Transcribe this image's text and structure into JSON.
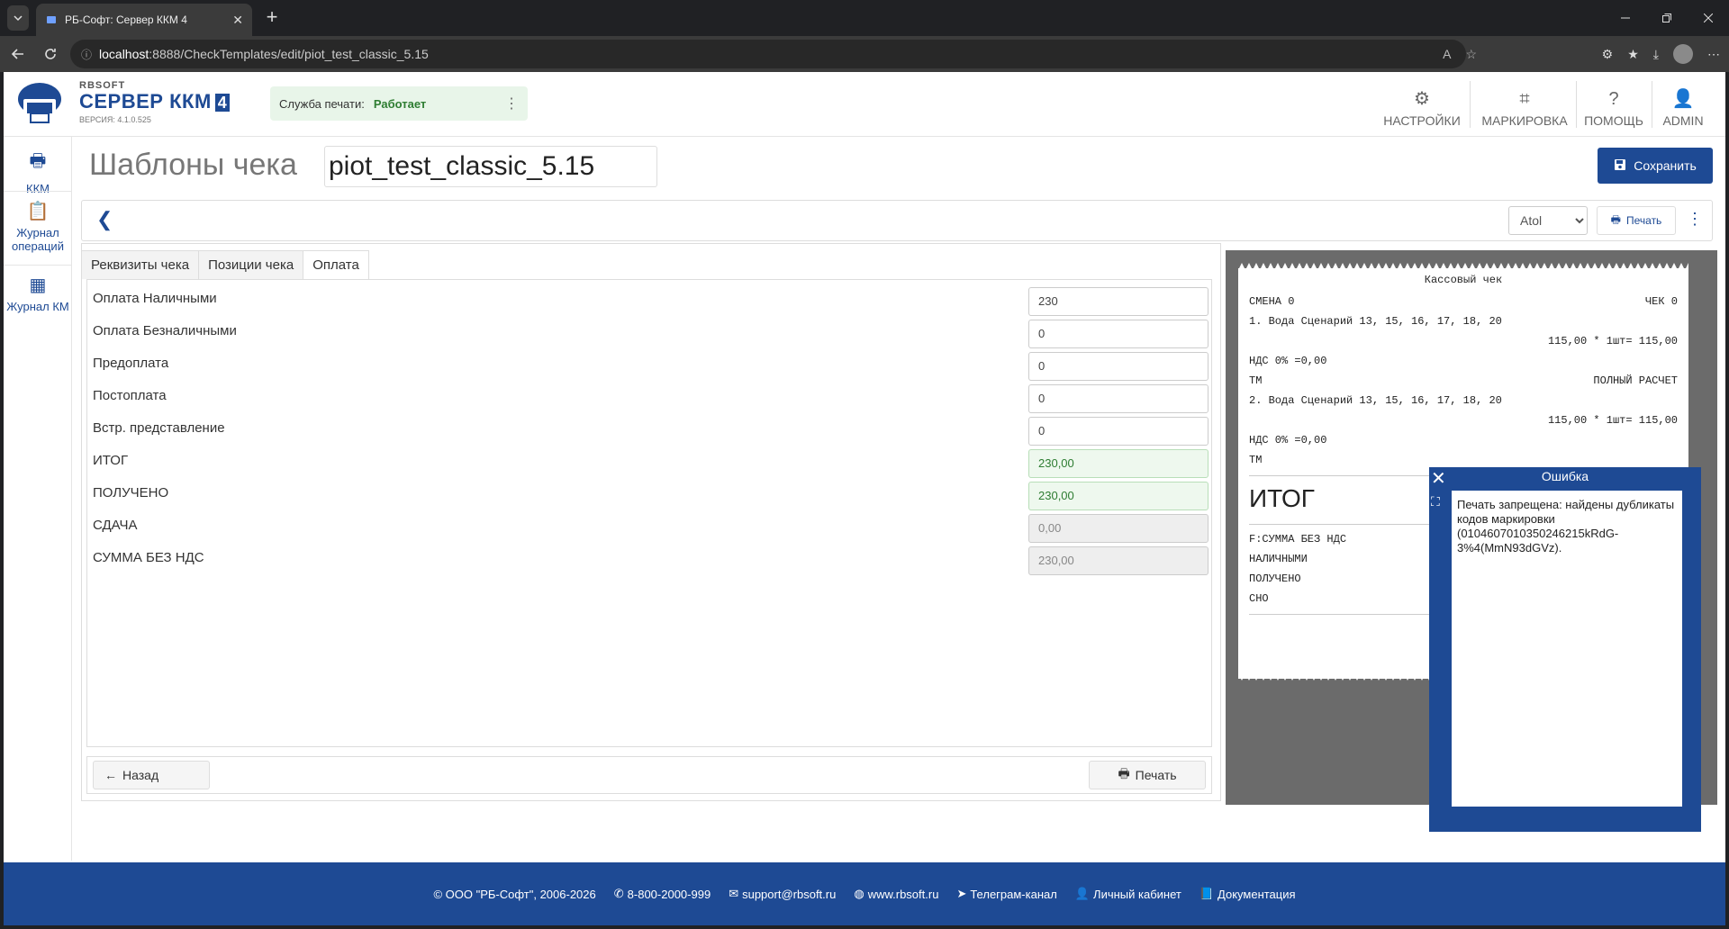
{
  "browser": {
    "tab_title": "РБ-Софт: Сервер ККМ 4",
    "url_host": "localhost",
    "url_path": ":8888/CheckTemplates/edit/piot_test_classic_5.15"
  },
  "header": {
    "brand": "RBSOFT",
    "product": "СЕРВЕР ККМ",
    "product_version_badge": "4",
    "version": "ВЕРСИЯ: 4.1.0.525",
    "print_service_label": "Служба печати:",
    "print_service_status": "Работает",
    "nav": {
      "settings": "НАСТРОЙКИ",
      "marking": "МАРКИРОВКА",
      "help": "ПОМОЩЬ",
      "admin": "ADMIN"
    }
  },
  "sidebar": {
    "items": [
      {
        "label": "ККМ"
      },
      {
        "label": "Журнал операций"
      },
      {
        "label": "Журнал КМ"
      }
    ]
  },
  "page": {
    "title": "Шаблоны чека",
    "template_name": "piot_test_classic_5.15",
    "save_label": "Сохранить"
  },
  "toolbar": {
    "format_selected": "Atol",
    "print_label": "Печать"
  },
  "tabs": [
    {
      "label": "Реквизиты чека"
    },
    {
      "label": "Позиции чека"
    },
    {
      "label": "Оплата"
    }
  ],
  "payment": {
    "rows": [
      {
        "label": "Оплата Наличными",
        "value": "230"
      },
      {
        "label": "Оплата Безналичными",
        "value": "0"
      },
      {
        "label": "Предоплата",
        "value": "0"
      },
      {
        "label": "Постоплата",
        "value": "0"
      },
      {
        "label": "Встр. представление",
        "value": "0"
      },
      {
        "label": "ИТОГ",
        "value": "230,00"
      },
      {
        "label": "ПОЛУЧЕНО",
        "value": "230,00"
      },
      {
        "label": "СДАЧА",
        "value": "0,00"
      },
      {
        "label": "СУММА БЕЗ НДС",
        "value": "230,00"
      }
    ]
  },
  "bottom": {
    "back_label": "Назад",
    "print_label": "Печать"
  },
  "receipt": {
    "title": "Кассовый чек",
    "shift": "СМЕНА 0",
    "check": "ЧЕК 0",
    "item1": "1. Вода Сценарий 13, 15, 16, 17, 18, 20",
    "item1_price": "115,00 * 1шт= 115,00",
    "vat1": "НДС 0% =0,00",
    "tm1": "ТМ",
    "full_payment": "ПОЛНЫЙ РАСЧЕТ",
    "item2": "2. Вода Сценарий 13, 15, 16, 17, 18, 20",
    "item2_price": "115,00 * 1шт= 115,00",
    "vat2": "НДС 0% =0,00",
    "tm2": "ТМ",
    "total": "ИТОГ",
    "f_sum": "F:СУММА БЕЗ НДС",
    "cash": "НАЛИЧНЫМИ",
    "received": "ПОЛУЧЕНО",
    "sno": "СНО"
  },
  "error": {
    "title": "Ошибка",
    "message": "Печать запрещена: найдены дубликаты кодов маркировки (0104607010350246215kRdG-3%4(MmN93dGVz)."
  },
  "footer": {
    "copyright": "© ООО \"РБ-Софт\", 2006-2026",
    "phone": "8-800-2000-999",
    "email": "support@rbsoft.ru",
    "site": "www.rbsoft.ru",
    "telegram": "Телеграм-канал",
    "cabinet": "Личный кабинет",
    "docs": "Документация"
  },
  "colors": {
    "brand": "#1e4a94",
    "success": "#2e7d32"
  }
}
